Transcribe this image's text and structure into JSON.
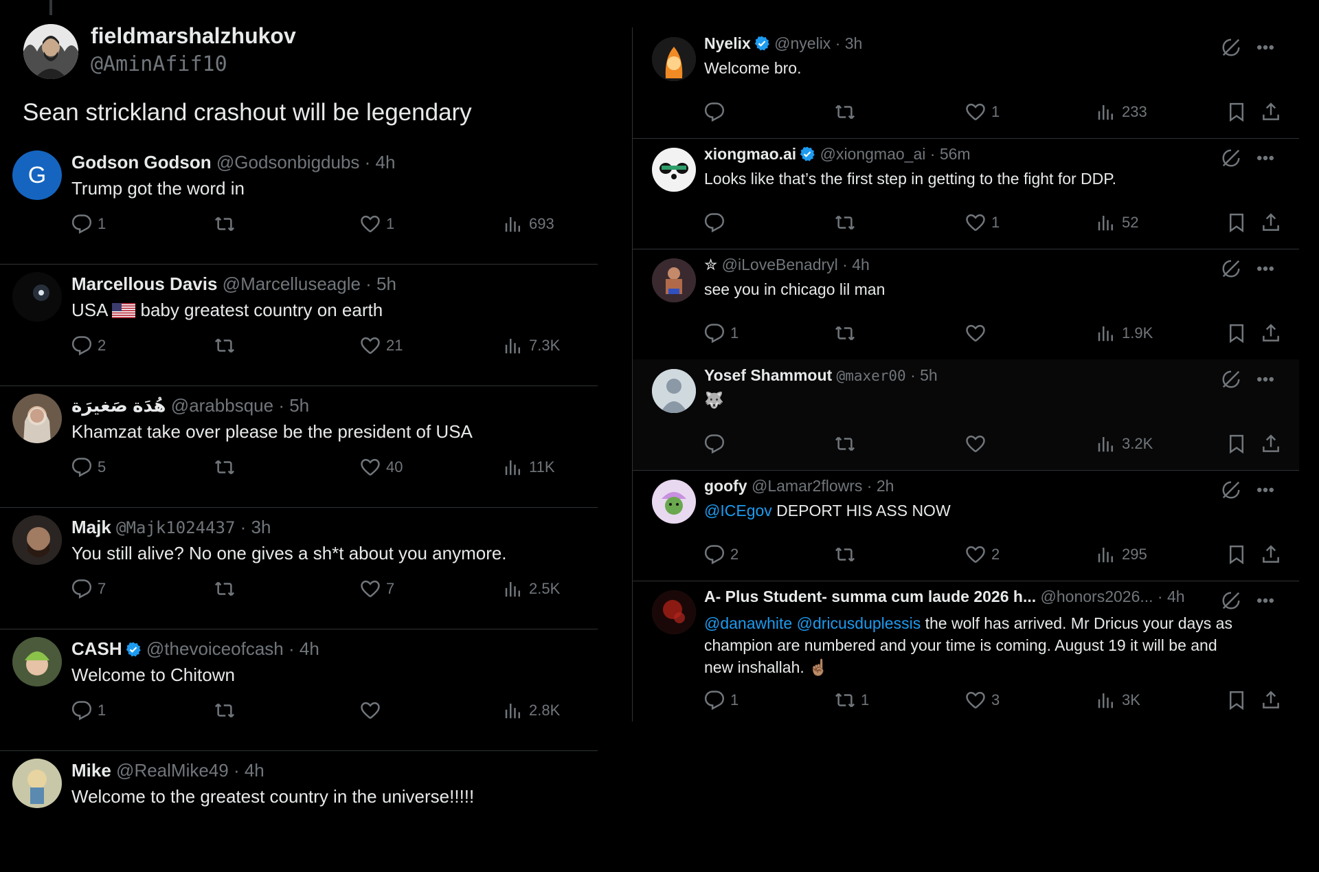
{
  "op": {
    "name": "fieldmarshalzhukov",
    "handle": "@AminAfif10",
    "text": "Sean strickland crashout will be legendary"
  },
  "left_replies": [
    {
      "name": "Godson Godson",
      "handle": "@Godsonbigdubs",
      "time": "· 4h",
      "text": "Trump got the word in",
      "replies": "1",
      "reposts": "",
      "likes": "1",
      "views": "693",
      "avatar_letter": "G"
    },
    {
      "name": "Marcellous Davis",
      "handle": "@Marcelluseagle",
      "time": "· 5h",
      "text_before": "USA",
      "text_after": "baby greatest country on earth",
      "replies": "2",
      "reposts": "",
      "likes": "21",
      "views": "7.3K"
    },
    {
      "name": "هُدَة صَغيرَة",
      "handle": "@arabbsque",
      "time": "· 5h",
      "text": "Khamzat take over please be the president of USA",
      "replies": "5",
      "reposts": "",
      "likes": "40",
      "views": "11K"
    },
    {
      "name": "Majk",
      "handle": "@Majk1024437",
      "time": "· 3h",
      "text": "You still alive? No one gives a sh*t about you anymore.",
      "replies": "7",
      "reposts": "",
      "likes": "7",
      "views": "2.5K"
    },
    {
      "name": "CASH",
      "handle": "@thevoiceofcash",
      "time": "· 4h",
      "text": "Welcome to Chitown",
      "replies": "1",
      "reposts": "",
      "likes": "",
      "views": "2.8K"
    },
    {
      "name": "Mike",
      "handle": "@RealMike49",
      "time": "· 4h",
      "text": "Welcome to the greatest country in the universe!!!!!"
    }
  ],
  "right_replies": [
    {
      "name": "Nyelix",
      "handle": "@nyelix",
      "time": "· 3h",
      "text": "Welcome bro.",
      "replies": "",
      "reposts": "",
      "likes": "1",
      "views": "233"
    },
    {
      "name": "xiongmao.ai",
      "handle": "@xiongmao_ai",
      "time": "· 56m",
      "text": "Looks like that’s the first step in getting to the fight for DDP.",
      "replies": "",
      "reposts": "",
      "likes": "1",
      "views": "52"
    },
    {
      "name": "✮",
      "handle": "@iLoveBenadryl",
      "time": "· 4h",
      "text": "see you in chicago lil man",
      "replies": "1",
      "reposts": "",
      "likes": "",
      "views": "1.9K"
    },
    {
      "name": "Yosef Shammout",
      "handle": "@maxer00",
      "time": "· 5h",
      "text": "🐺",
      "replies": "",
      "reposts": "",
      "likes": "",
      "views": "3.2K"
    },
    {
      "name": "goofy",
      "handle": "@Lamar2flowrs",
      "time": "· 2h",
      "mention": "@ICEgov",
      "text": "DEPORT HIS ASS NOW",
      "replies": "2",
      "reposts": "",
      "likes": "2",
      "views": "295"
    },
    {
      "name": "A- Plus Student- summa cum laude 2026 h...",
      "handle": "@honors2026...",
      "time": "· 4h",
      "mention1": "@danawhite",
      "mention2": "@dricusduplessis",
      "text_line1": "the wolf has arrived.  Mr Dricus your days as",
      "text_line2": "champion are numbered and your time is coming.   August 19 it will be and",
      "text_line3": "new inshallah.",
      "emoji": "☝🏽",
      "replies": "1",
      "reposts": "1",
      "likes": "3",
      "views": "3K"
    }
  ],
  "colors": {
    "background": "#000000",
    "text": "#e7e9ea",
    "muted": "#71767b",
    "accent": "#1d9bf0",
    "divider": "#2f3336"
  },
  "icons": [
    "reply-icon",
    "repost-icon",
    "like-icon",
    "views-icon",
    "bookmark-icon",
    "share-icon",
    "grok-icon",
    "more-icon",
    "verified-badge-icon"
  ]
}
